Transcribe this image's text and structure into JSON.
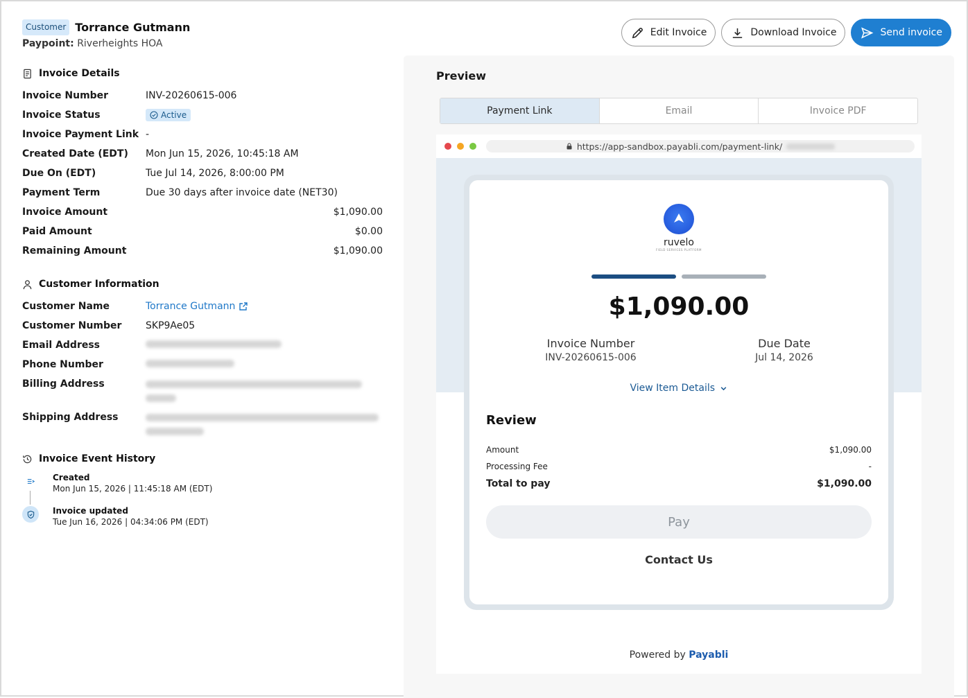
{
  "header": {
    "badge": "Customer",
    "customer_name": "Torrance Gutmann",
    "paypoint_label": "Paypoint:",
    "paypoint_value": "Riverheights HOA"
  },
  "actions": {
    "edit": "Edit Invoice",
    "download": "Download Invoice",
    "send": "Send invoice"
  },
  "invoice_details": {
    "title": "Invoice Details",
    "rows": {
      "number": {
        "label": "Invoice Number",
        "value": "INV-20260615-006"
      },
      "status": {
        "label": "Invoice Status",
        "value": "Active"
      },
      "payment_link": {
        "label": "Invoice Payment Link",
        "value": "-"
      },
      "created": {
        "label": "Created Date (EDT)",
        "value": "Mon Jun 15, 2026, 10:45:18 AM"
      },
      "due": {
        "label": "Due On (EDT)",
        "value": "Tue Jul 14, 2026, 8:00:00 PM"
      },
      "term": {
        "label": "Payment Term",
        "value": "Due 30 days after invoice date (NET30)"
      },
      "amount": {
        "label": "Invoice Amount",
        "value": "$1,090.00"
      },
      "paid": {
        "label": "Paid Amount",
        "value": "$0.00"
      },
      "remaining": {
        "label": "Remaining Amount",
        "value": "$1,090.00"
      }
    }
  },
  "customer_info": {
    "title": "Customer Information",
    "name_label": "Customer Name",
    "name_value": "Torrance Gutmann",
    "number_label": "Customer Number",
    "number_value": "SKP9Ae05",
    "email_label": "Email Address",
    "phone_label": "Phone Number",
    "billing_label": "Billing Address",
    "shipping_label": "Shipping Address"
  },
  "history": {
    "title": "Invoice Event History",
    "events": [
      {
        "title": "Created",
        "date": "Mon Jun 15, 2026 | 11:45:18 AM (EDT)"
      },
      {
        "title": "Invoice updated",
        "date": "Tue Jun 16, 2026 | 04:34:06 PM (EDT)"
      }
    ]
  },
  "preview": {
    "title": "Preview",
    "tabs": [
      "Payment Link",
      "Email",
      "Invoice PDF"
    ],
    "active_tab": "Payment Link",
    "url": "https://app-sandbox.payabli.com/payment-link/",
    "logo_name": "ruvelo",
    "logo_tagline": "FIELD SERVICES PLATFORM",
    "progress_step": 1,
    "progress_total": 2,
    "amount": "$1,090.00",
    "invoice_number_label": "Invoice Number",
    "invoice_number": "INV-20260615-006",
    "due_date_label": "Due Date",
    "due_date": "Jul 14, 2026",
    "view_details": "View Item Details",
    "review_title": "Review",
    "review": {
      "amount_label": "Amount",
      "amount": "$1,090.00",
      "fee_label": "Processing Fee",
      "fee": "-",
      "total_label": "Total to pay",
      "total": "$1,090.00"
    },
    "pay_label": "Pay",
    "contact_label": "Contact Us",
    "powered_by": "Powered by",
    "powered_brand": "Payabli"
  },
  "colors": {
    "primary": "#1f7fd1",
    "link": "#1f78c8",
    "active_status_bg": "#d4e8f9",
    "progress_active": "#1c4e82"
  }
}
